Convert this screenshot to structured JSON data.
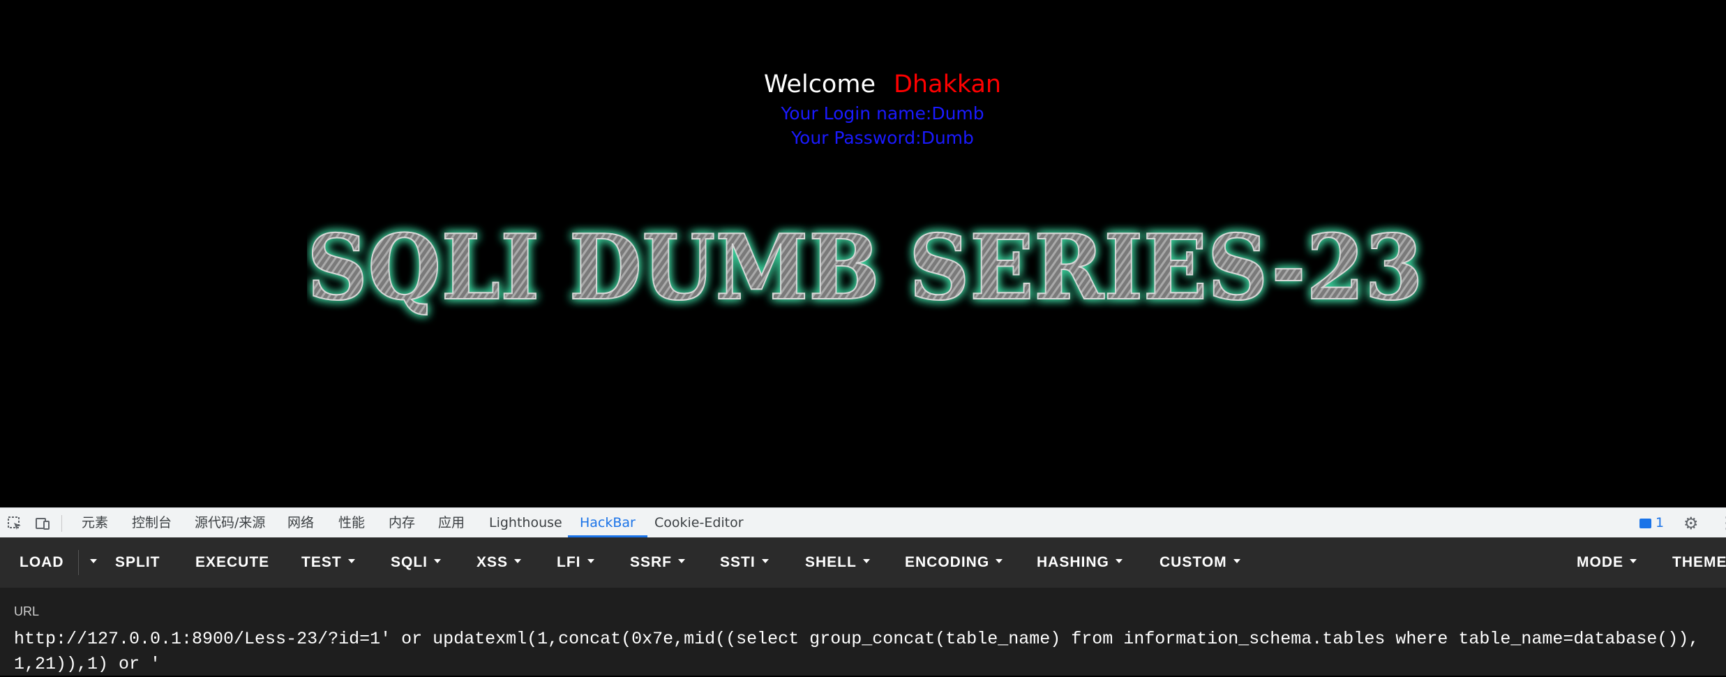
{
  "page": {
    "welcome": "Welcome",
    "user_display": "Dhakkan",
    "login_name": "Your Login name:Dumb",
    "password": "Your Password:Dumb",
    "banner": "SQLI DUMB SERIES-23"
  },
  "devtools": {
    "tabs": [
      "元素",
      "控制台",
      "源代码/来源",
      "网络",
      "性能",
      "内存",
      "应用",
      "Lighthouse",
      "HackBar",
      "Cookie-Editor"
    ],
    "active_tab": "HackBar",
    "issue_count": "1"
  },
  "hackbar": {
    "buttons": [
      "LOAD",
      "SPLIT",
      "EXECUTE",
      "TEST",
      "SQLI",
      "XSS",
      "LFI",
      "SSRF",
      "SSTI",
      "SHELL",
      "ENCODING",
      "HASHING",
      "CUSTOM",
      "MODE",
      "THEME"
    ],
    "url_label": "URL",
    "url_value": "http://127.0.0.1:8900/Less-23/?id=1' or updatexml(1,concat(0x7e,mid((select group_concat(table_name) from information_schema.tables where table_name=database()),1,21)),1) or '"
  },
  "colors": {
    "welcome": "#ffffff",
    "user": "#ff0000",
    "info": "#1a1aff",
    "banner_glow": "#3dd6a0",
    "active_tab": "#1a73e8"
  }
}
